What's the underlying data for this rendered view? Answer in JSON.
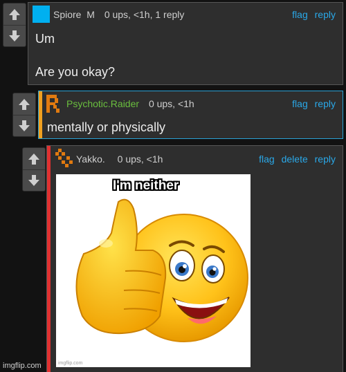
{
  "comments": [
    {
      "username": "Spiore  M",
      "meta": "0 ups, <1h, 1 reply",
      "actions": [
        "flag",
        "reply"
      ],
      "body_lines": [
        "Um",
        "Are you okay?"
      ],
      "avatar_color": "#00b0f0"
    },
    {
      "username": "Psychotic.Raider",
      "meta": "0 ups, <1h",
      "actions": [
        "flag",
        "reply"
      ],
      "body_lines": [
        "mentally or physically"
      ],
      "username_color": "#6abf3e",
      "stripe_color": "#f0a020",
      "avatar_color": "#e07a10"
    },
    {
      "username": "Yakko.",
      "meta": "0 ups, <1h",
      "actions": [
        "flag",
        "delete",
        "reply"
      ],
      "image_caption": "I'm neither",
      "image_watermark": "imgflip.com",
      "stripe_color": "#e03030",
      "avatar_color": "#e07a10"
    }
  ],
  "vote_icons": {
    "up": "arrow-up-icon",
    "down": "arrow-down-icon"
  },
  "site_watermark": "imgflip.com",
  "colors": {
    "link": "#2aa8e8",
    "background": "#121212",
    "card": "#2e2e2e"
  }
}
